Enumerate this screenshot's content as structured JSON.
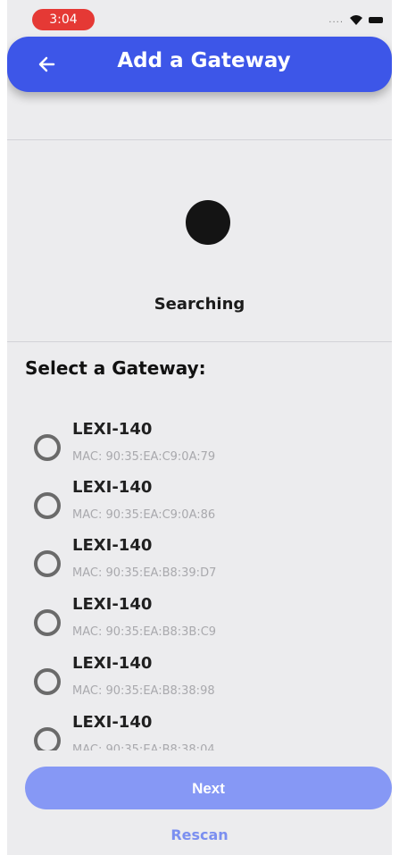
{
  "status_bar": {
    "time": "3:04",
    "signal": "....",
    "wifi_icon": "wifi-icon",
    "battery_icon": "battery-icon"
  },
  "header": {
    "title": "Add a Gateway",
    "back_icon": "arrow-left-icon"
  },
  "search": {
    "status": "Searching"
  },
  "gateways": {
    "heading": "Select a Gateway:",
    "items": [
      {
        "name": "LEXI-140",
        "mac": "MAC: 90:35:EA:C9:0A:79"
      },
      {
        "name": "LEXI-140",
        "mac": "MAC: 90:35:EA:C9:0A:86"
      },
      {
        "name": "LEXI-140",
        "mac": "MAC: 90:35:EA:B8:39:D7"
      },
      {
        "name": "LEXI-140",
        "mac": "MAC: 90:35:EA:B8:3B:C9"
      },
      {
        "name": "LEXI-140",
        "mac": "MAC: 90:35:EA:B8:38:98"
      },
      {
        "name": "LEXI-140",
        "mac": "MAC: 90:35:EA:B8:38:04"
      }
    ]
  },
  "actions": {
    "next_label": "Next",
    "rescan_label": "Rescan"
  },
  "colors": {
    "primary": "#3d56e8",
    "button_disabled": "#8698f5",
    "time_pill": "#e53935"
  }
}
